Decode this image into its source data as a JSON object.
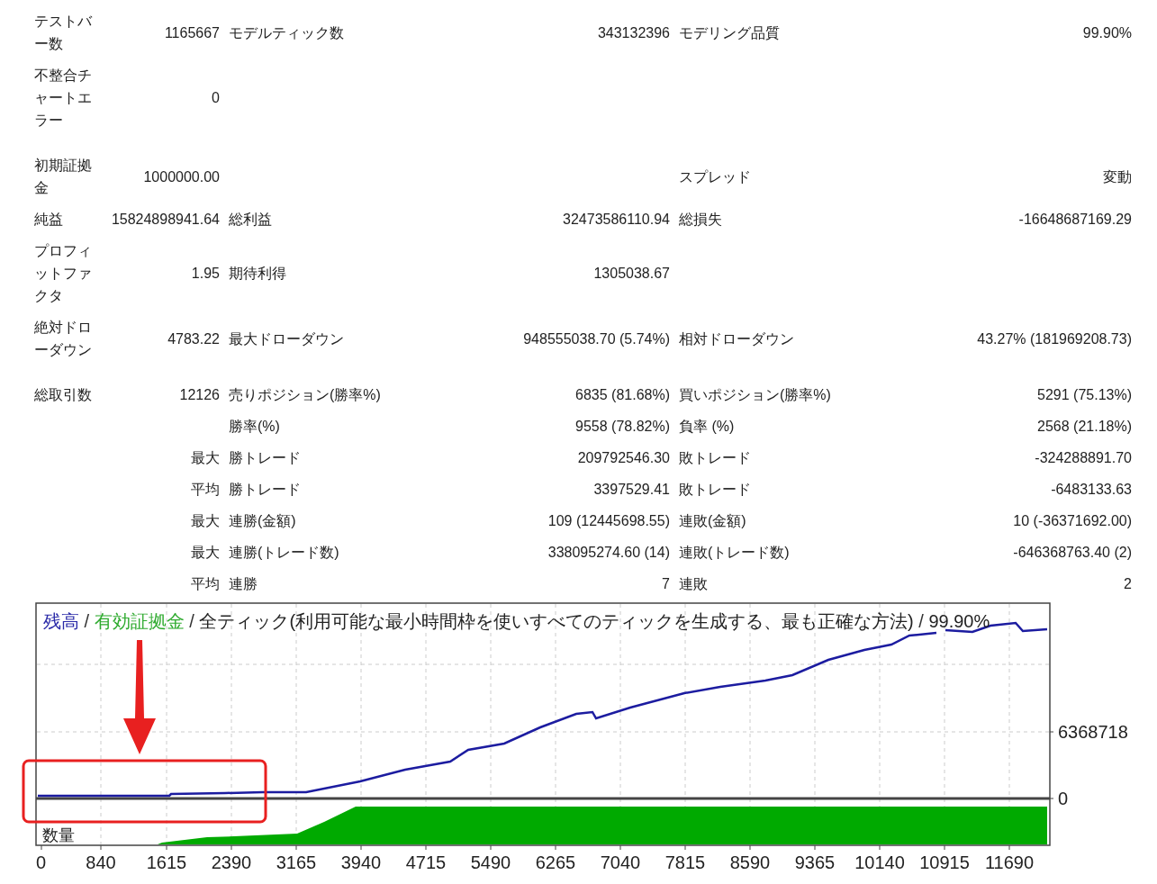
{
  "report": {
    "sections": [
      [
        {
          "label_1": "テストバー数",
          "value_1": "1165667",
          "label_2": "モデルティック数",
          "value_2": "343132396",
          "label_3": "モデリング品質",
          "value_3": "99.90%"
        },
        {
          "label_1": "不整合チャートエラー",
          "value_1": "0"
        }
      ],
      [
        {
          "label_1": "初期証拠金",
          "value_1": "1000000.00",
          "label_3": "スプレッド",
          "value_3": "変動"
        },
        {
          "label_1": "純益",
          "value_1": "15824898941.64",
          "label_2": "総利益",
          "value_2": "32473586110.94",
          "label_3": "総損失",
          "value_3": "-16648687169.29"
        },
        {
          "label_1": "プロフィットファクタ",
          "value_1": "1.95",
          "label_2": "期待利得",
          "value_2": "1305038.67"
        },
        {
          "label_1": "絶対ドローダウン",
          "value_1": "4783.22",
          "label_2": "最大ドローダウン",
          "value_2": "948555038.70 (5.74%)",
          "label_3": "相対ドローダウン",
          "value_3": "43.27% (181969208.73)"
        }
      ],
      [
        {
          "label_1": "総取引数",
          "value_1": "12126",
          "label_2": "売りポジション(勝率%)",
          "value_2": "6835 (81.68%)",
          "label_3": "買いポジション(勝率%)",
          "value_3": "5291 (75.13%)"
        },
        {
          "label_2": "勝率(%)",
          "value_2": "9558 (78.82%)",
          "label_3": "負率 (%)",
          "value_3": "2568 (21.18%)"
        },
        {
          "value_1": "最大",
          "label_2": "勝トレード",
          "value_2": "209792546.30",
          "label_3": "敗トレード",
          "value_3": "-324288891.70"
        },
        {
          "value_1": "平均",
          "label_2": "勝トレード",
          "value_2": "3397529.41",
          "label_3": "敗トレード",
          "value_3": "-6483133.63"
        },
        {
          "value_1": "最大",
          "label_2": "連勝(金額)",
          "value_2": "109 (12445698.55)",
          "label_3": "連敗(金額)",
          "value_3": "10 (-36371692.00)"
        },
        {
          "value_1": "最大",
          "label_2": "連勝(トレード数)",
          "value_2": "338095274.60 (14)",
          "label_3": "連敗(トレード数)",
          "value_3": "-646368763.40 (2)"
        },
        {
          "value_1": "平均",
          "label_2": "連勝",
          "value_2": "7",
          "label_3": "連敗",
          "value_3": "2"
        }
      ]
    ]
  },
  "chart": {
    "legend_separator": "/",
    "legend": [
      {
        "text": "残高",
        "color": "#2a2aa8"
      },
      {
        "text": "有効証拠金",
        "color": "#2eaa2e"
      },
      {
        "text": "全ティック(利用可能な最小時間枠を使いすべてのティックを生成する、最も正確な方法)",
        "color": "#222222"
      },
      {
        "text": "99.90%",
        "color": "#222222"
      }
    ],
    "y_labels": [
      "6368718",
      "0"
    ],
    "volume_label": "数量",
    "x_labels": [
      "0",
      "840",
      "1615",
      "2390",
      "3165",
      "3940",
      "4715",
      "5490",
      "6265",
      "7040",
      "7815",
      "8590",
      "9365",
      "10140",
      "10915",
      "11690"
    ]
  }
}
